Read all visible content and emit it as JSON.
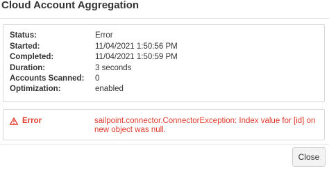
{
  "dialog": {
    "title": "Cloud Account Aggregation"
  },
  "details": {
    "status": {
      "label": "Status:",
      "value": "Error"
    },
    "started": {
      "label": "Started:",
      "value": "11/04/2021 1:50:56 PM"
    },
    "completed": {
      "label": "Completed:",
      "value": "11/04/2021 1:50:59 PM"
    },
    "duration": {
      "label": "Duration:",
      "value": "3 seconds"
    },
    "accounts_scanned": {
      "label": "Accounts Scanned:",
      "value": "0"
    },
    "optimization": {
      "label": "Optimization:",
      "value": "enabled"
    }
  },
  "error": {
    "icon": "warning-triangle-icon",
    "label": "Error",
    "message": "sailpoint.connector.ConnectorException: Index value for [id] on new object was null.",
    "color": "#e03b2d"
  },
  "footer": {
    "close_label": "Close"
  }
}
